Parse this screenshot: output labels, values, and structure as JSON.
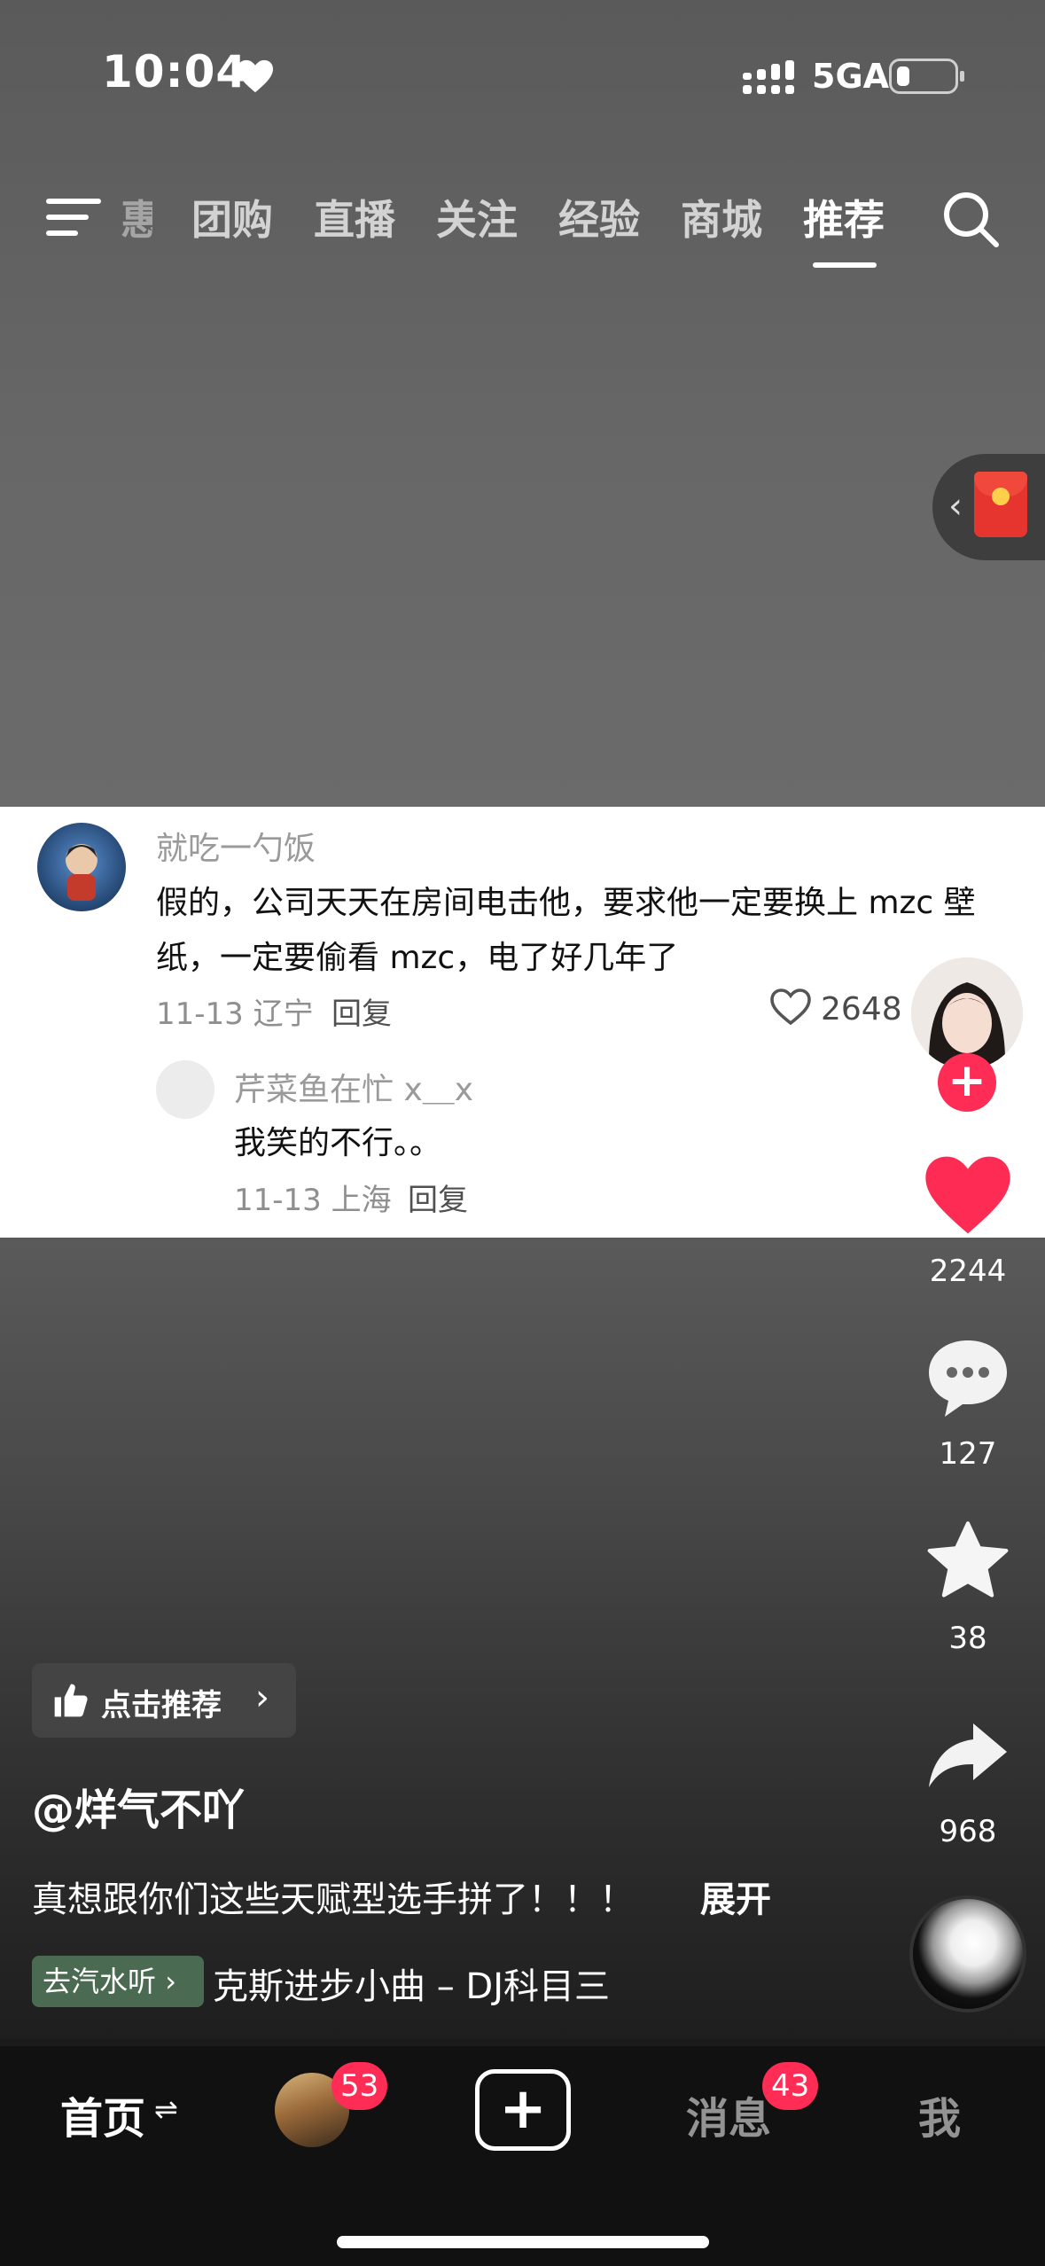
{
  "status_bar": {
    "time": "10:04",
    "network": "5GA"
  },
  "top_tabs": [
    {
      "label": "惠"
    },
    {
      "label": "团购"
    },
    {
      "label": "直播"
    },
    {
      "label": "关注"
    },
    {
      "label": "经验"
    },
    {
      "label": "商城"
    },
    {
      "label": "推荐"
    }
  ],
  "active_tab": "推荐",
  "comment": {
    "username": "就吃一勺饭",
    "text": "假的，公司天天在房间电击他，要求他一定要换上 mzc 壁纸，一定要偷看 mzc，电了好几年了",
    "date_location": "11-13 辽宁",
    "reply_label": "回复",
    "likes": "2648",
    "reply": {
      "username": "芹菜鱼在忙 x＿x",
      "text": "我笑的不行。。",
      "date_location": "11-13 上海",
      "reply_label": "回复"
    }
  },
  "right_rail": {
    "follow_symbol": "+",
    "likes": "2244",
    "comments": "127",
    "favorites": "38",
    "shares": "968"
  },
  "video_info": {
    "recommend_label": "点击推荐",
    "author": "@烊气不吖",
    "caption": "真想跟你们这些天赋型选手拼了！！！",
    "expand_label": "展开",
    "music_tag": "去汽水听",
    "music_track": "克斯进步小曲 – DJ科目三"
  },
  "bottom_nav": {
    "home": "首页",
    "friends_badge": "53",
    "messages": "消息",
    "messages_badge": "43",
    "me": "我"
  },
  "colors": {
    "accent": "#ff2c55",
    "music_tag": "#4a6b52"
  }
}
